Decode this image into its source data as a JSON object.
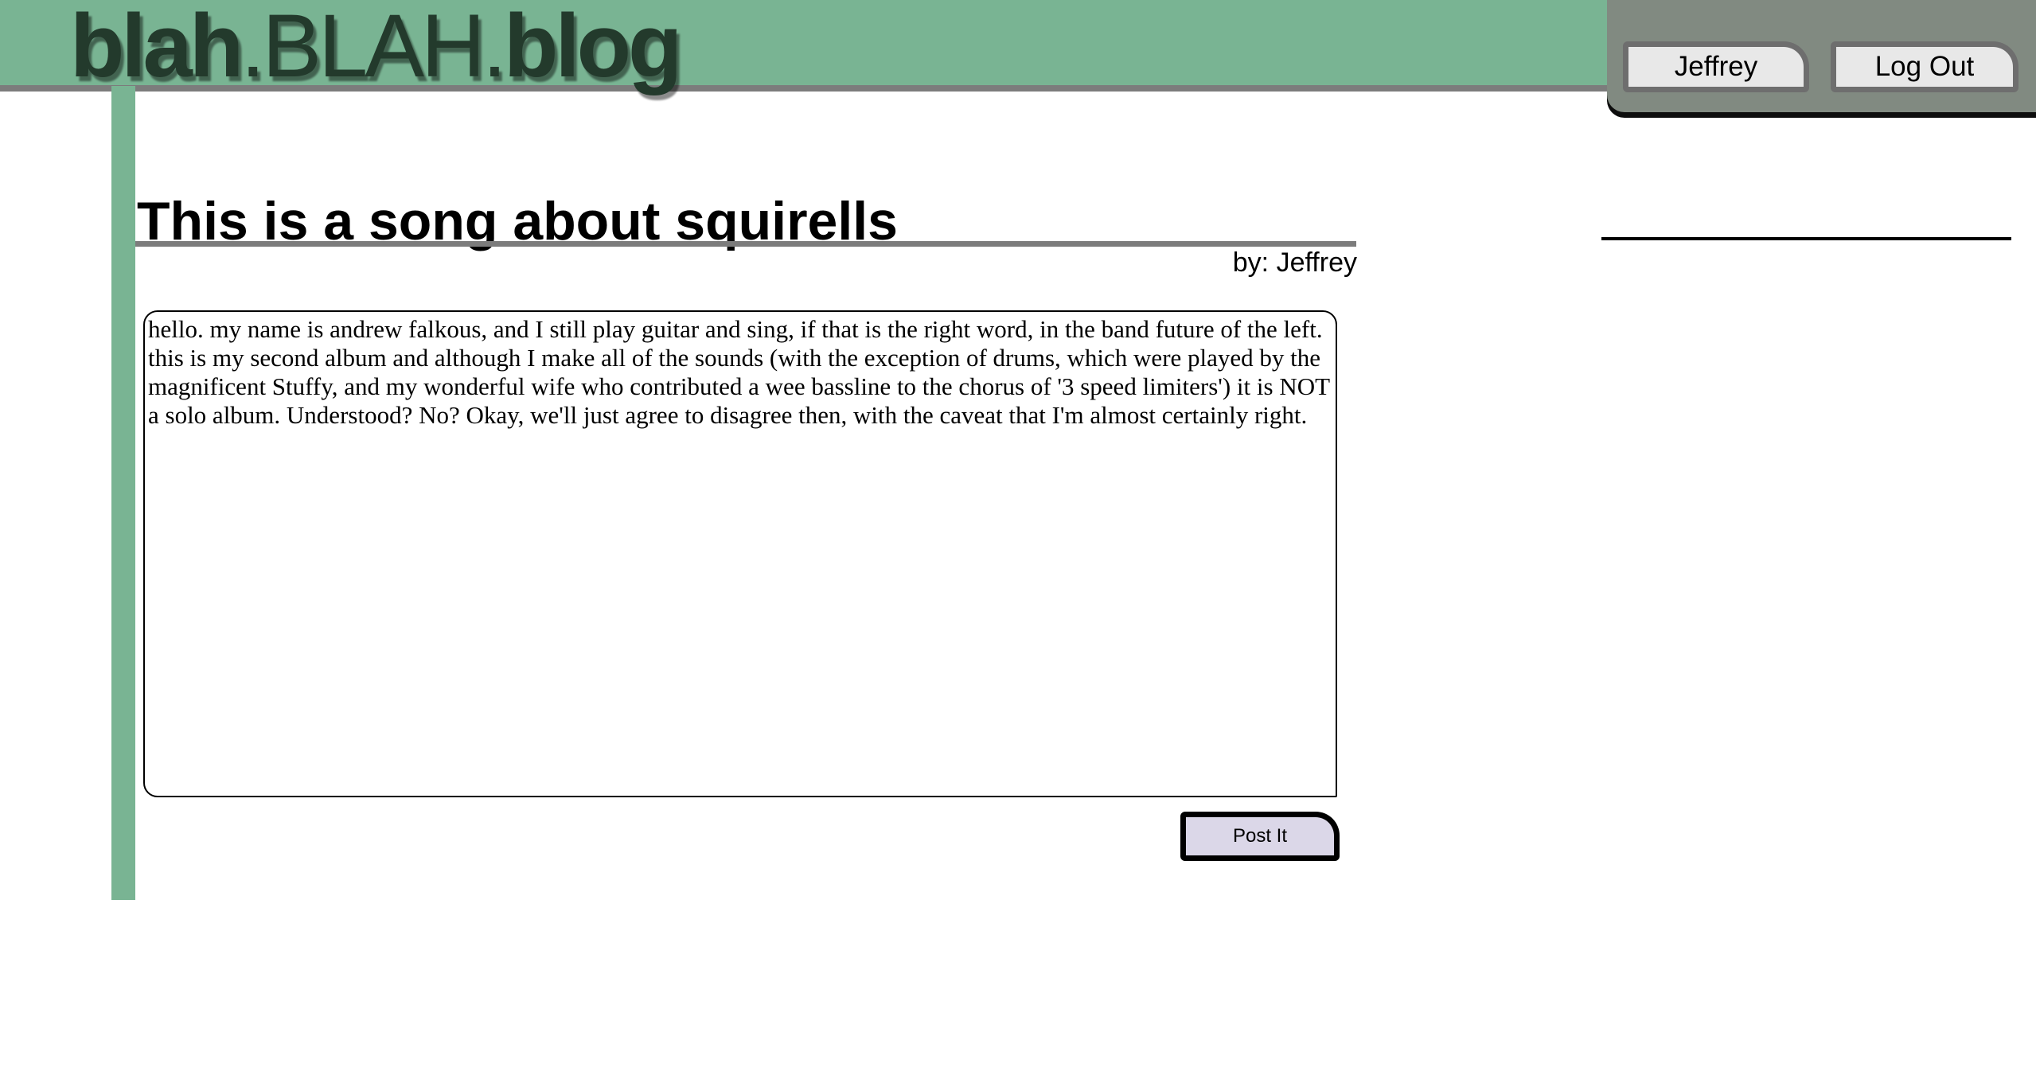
{
  "site": {
    "logo_part1": "blah",
    "logo_part2": ".BLAH.",
    "logo_part3": "blog"
  },
  "nav": {
    "user_label": "Jeffrey",
    "logout_label": "Log Out"
  },
  "post": {
    "title": "This is a song about squirells",
    "byline": "by: Jeffrey",
    "body": "hello. my name is andrew falkous, and I still play guitar and sing, if that is the right word, in the band future of the left. this is my second album and although I make all of the sounds (with the exception of drums, which were played by the magnificent Stuffy, and my wonderful wife who contributed a wee bassline to the chorus of '3 speed limiters') it is NOT a solo album. Understood? No? Okay, we'll just agree to disagree then, with the caveat that I'm almost certainly right.",
    "submit_label": "Post It"
  },
  "colors": {
    "header_green": "#79b493",
    "panel_gray": "#818a81",
    "rule_gray": "#7c7c7c",
    "submit_lavender": "#dbd7e8"
  }
}
